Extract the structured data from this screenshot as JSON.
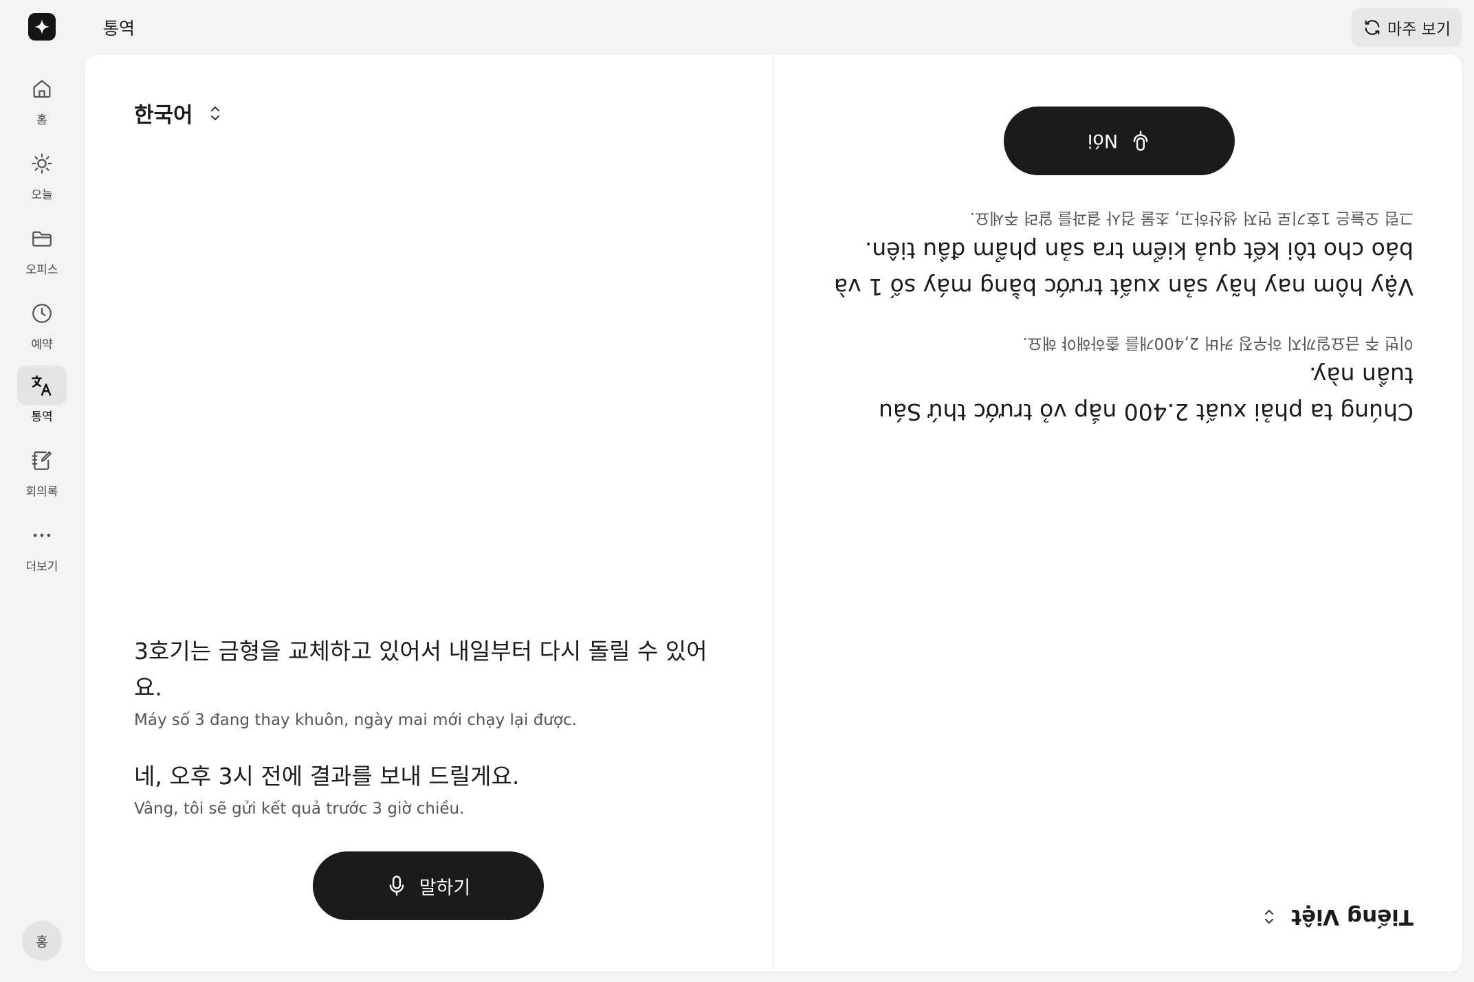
{
  "app": {
    "page_title": "통역",
    "flip_label": "마주 보기"
  },
  "sidebar": {
    "items": [
      {
        "label": "홈",
        "icon": "home-icon"
      },
      {
        "label": "오늘",
        "icon": "sun-icon"
      },
      {
        "label": "오피스",
        "icon": "folder-icon"
      },
      {
        "label": "예약",
        "icon": "clock-icon"
      },
      {
        "label": "통역",
        "icon": "translate-icon",
        "active": true
      },
      {
        "label": "회의록",
        "icon": "notes-icon"
      },
      {
        "label": "더보기",
        "icon": "more-icon"
      }
    ],
    "avatar_label": "홍"
  },
  "left_pane": {
    "language": "한국어",
    "speak_label": "말하기",
    "messages": [
      {
        "main": "3호기는 금형을 교체하고 있어서 내일부터 다시 돌릴 수 있어요.",
        "sub": "Máy số 3 đang thay khuôn, ngày mai mới chạy lại được."
      },
      {
        "main": "네, 오후 3시 전에 결과를 보내 드릴게요.",
        "sub": "Vâng, tôi sẽ gửi kết quả trước 3 giờ chiều."
      }
    ]
  },
  "right_pane": {
    "language": "Tiếng Việt",
    "speak_label": "Nói",
    "messages": [
      {
        "main": "Chúng ta phải xuất 2.400 nắp vỏ trước thứ Sáu tuần này.",
        "sub": "이번 주 금요일까지 하우징 커버 2,400개를 출하해야 해요."
      },
      {
        "main": "Vậy hôm nay hãy sản xuất trước bằng máy số 1 và báo cho tôi kết quả kiểm tra sản phẩm đầu tiên.",
        "sub": "그럼 오늘은 1호기로 먼저 생산하고, 초물 검사 결과를 알려 주세요."
      }
    ]
  },
  "colors": {
    "background": "#f3f3f3",
    "card": "#ffffff",
    "button": "#1b1b1b",
    "active_nav": "#e4e4e4"
  }
}
